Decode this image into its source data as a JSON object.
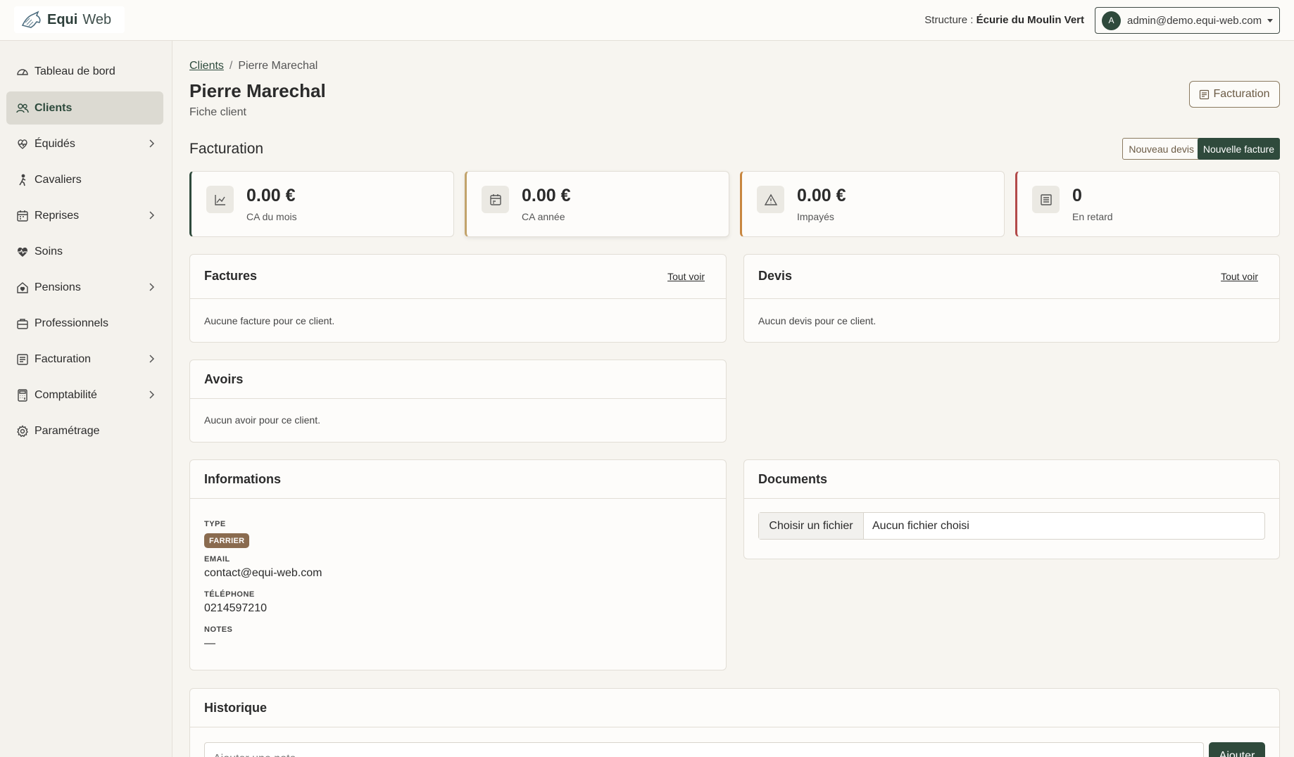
{
  "app": {
    "logo_bold": "Equi",
    "logo_light": "Web"
  },
  "topbar": {
    "structure_label": "Structure : ",
    "structure_name": "Écurie du Moulin Vert",
    "user_initial": "A",
    "user_email": "admin@demo.equi-web.com"
  },
  "sidebar": {
    "items": [
      {
        "label": "Tableau de bord",
        "icon": "gauge-icon",
        "chevron": false
      },
      {
        "label": "Clients",
        "icon": "users-icon",
        "chevron": false,
        "active": true
      },
      {
        "label": "Équidés",
        "icon": "horse-icon",
        "chevron": true
      },
      {
        "label": "Cavaliers",
        "icon": "rider-icon",
        "chevron": false
      },
      {
        "label": "Reprises",
        "icon": "calendar-icon",
        "chevron": true
      },
      {
        "label": "Soins",
        "icon": "heart-pulse-icon",
        "chevron": false
      },
      {
        "label": "Pensions",
        "icon": "house-heart-icon",
        "chevron": true
      },
      {
        "label": "Professionnels",
        "icon": "briefcase-icon",
        "chevron": false
      },
      {
        "label": "Facturation",
        "icon": "receipt-icon",
        "chevron": true
      },
      {
        "label": "Comptabilité",
        "icon": "calculator-icon",
        "chevron": true
      },
      {
        "label": "Paramétrage",
        "icon": "gear-icon",
        "chevron": false
      }
    ]
  },
  "breadcrumb": {
    "parent": "Clients",
    "separator": "/",
    "current": "Pierre Marechal"
  },
  "page": {
    "title": "Pierre Marechal",
    "subtitle": "Fiche client",
    "header_button": "Facturation"
  },
  "billing": {
    "section_title": "Facturation",
    "new_quote": "Nouveau devis",
    "new_invoice": "Nouvelle facture",
    "stats": [
      {
        "value": "0.00 €",
        "label": "CA du mois",
        "accent": "#2f4a3c",
        "icon": "chart-line-icon"
      },
      {
        "value": "0.00 €",
        "label": "CA année",
        "accent": "#c2a36b",
        "icon": "calendar-money-icon"
      },
      {
        "value": "0.00 €",
        "label": "Impayés",
        "accent": "#c8863f",
        "icon": "warning-icon"
      },
      {
        "value": "0",
        "label": "En retard",
        "accent": "#b24a4a",
        "icon": "receipt-icon"
      }
    ]
  },
  "invoices": {
    "title": "Factures",
    "link": "Tout voir",
    "empty": "Aucune facture pour ce client."
  },
  "quotes": {
    "title": "Devis",
    "link": "Tout voir",
    "empty": "Aucun devis pour ce client."
  },
  "credits": {
    "title": "Avoirs",
    "empty": "Aucun avoir pour ce client."
  },
  "info": {
    "title": "Informations",
    "type_label": "TYPE",
    "type_value": "FARRIER",
    "email_label": "EMAIL",
    "email_value": "contact@equi-web.com",
    "phone_label": "TÉLÉPHONE",
    "phone_value": "0214597210",
    "notes_label": "NOTES",
    "notes_value": "—"
  },
  "documents": {
    "title": "Documents",
    "file_button": "Choisir un fichier",
    "file_status": "Aucun fichier choisi"
  },
  "history": {
    "title": "Historique",
    "placeholder": "Ajouter une note",
    "add_button": "Ajouter"
  }
}
